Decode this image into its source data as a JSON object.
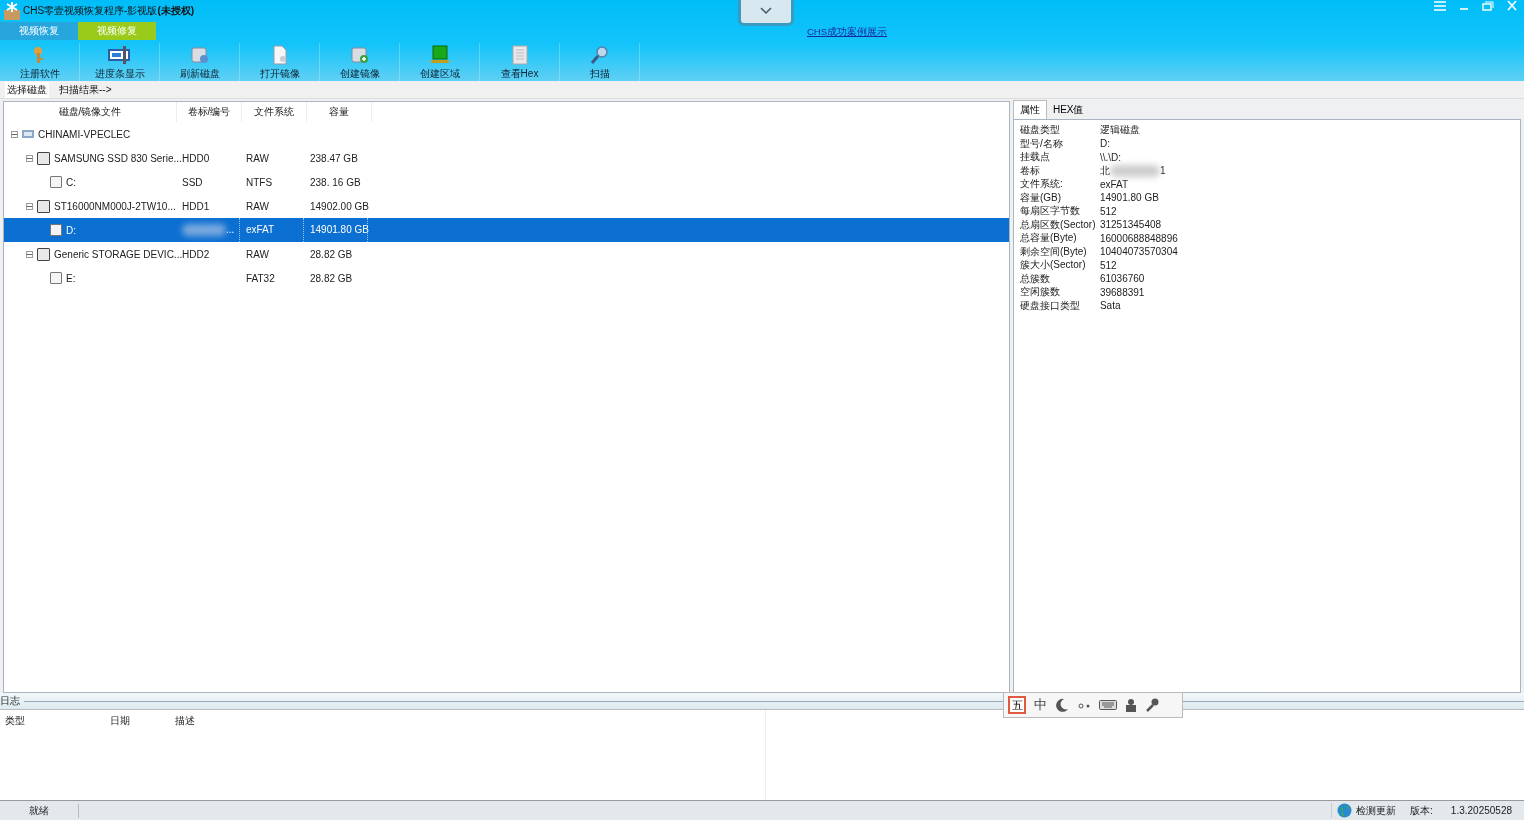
{
  "window": {
    "title": "CHS零壹视频恢复程序-影视版",
    "title_suffix": "(未授权)"
  },
  "mode_tabs": [
    {
      "label": "视频恢复",
      "selected": false
    },
    {
      "label": "视频修复",
      "selected": true
    }
  ],
  "link": "CHS成功案例展示",
  "toolbar": [
    {
      "kind": "key",
      "label": "注册软件"
    },
    {
      "kind": "monitor",
      "label": "进度条显示"
    },
    {
      "kind": "disk-refresh",
      "label": "刷新磁盘"
    },
    {
      "kind": "document",
      "label": "打开镜像"
    },
    {
      "kind": "disk-add",
      "label": "创建镜像"
    },
    {
      "kind": "green-block",
      "label": "创建区域"
    },
    {
      "kind": "hex",
      "label": "查看Hex"
    },
    {
      "kind": "magnifier",
      "label": "扫描"
    }
  ],
  "steps": [
    {
      "label": "选择磁盘",
      "selected": true
    },
    {
      "label": "扫描结果-->",
      "selected": false
    }
  ],
  "tree": {
    "columns": [
      "磁盘/镜像文件",
      "卷标/编号",
      "文件系统",
      "容量"
    ],
    "rows": [
      {
        "kind": "computer",
        "name": "CHINAMI-VPECLEC",
        "expanded": true,
        "children": [
          {
            "kind": "disk",
            "name": "SAMSUNG SSD 830 Serie...",
            "volume": "HDD0",
            "fs": "RAW",
            "size": "238.47 GB",
            "expanded": true,
            "selected": false,
            "children": [
              {
                "kind": "partition",
                "name": "C:",
                "volume": "SSD",
                "fs": "NTFS",
                "size": "238. 16 GB",
                "selected": false
              }
            ]
          },
          {
            "kind": "disk",
            "name": "ST16000NM000J-2TW10...",
            "volume": "HDD1",
            "fs": "RAW",
            "size": "14902.00 GB",
            "expanded": true,
            "selected": false,
            "children": [
              {
                "kind": "partition",
                "name": "D:",
                "volume": "...",
                "redacted": true,
                "fs": "exFAT",
                "size": "14901.80 GB",
                "selected": true
              }
            ]
          },
          {
            "kind": "disk",
            "name": "Generic STORAGE DEVIC...",
            "volume": "HDD2",
            "fs": "RAW",
            "size": "28.82 GB",
            "expanded": true,
            "selected": false,
            "children": [
              {
                "kind": "partition",
                "name": "E:",
                "fs": "FAT32",
                "size": "28.82 GB",
                "selected": false
              }
            ]
          }
        ]
      }
    ]
  },
  "props_tabs": [
    {
      "label": "属性",
      "selected": true
    },
    {
      "label": "HEX值",
      "selected": false
    }
  ],
  "properties": [
    {
      "label": "磁盘类型",
      "value": "逻辑磁盘"
    },
    {
      "label": "型号/名称",
      "value": "D:"
    },
    {
      "label": "挂载点",
      "value": "\\\\.\\D:"
    },
    {
      "label": "卷标",
      "value": "北",
      "value_end": "1",
      "redacted": true
    },
    {
      "label": "文件系统:",
      "value": "exFAT"
    },
    {
      "label": "容量(GB)",
      "value": "14901.80 GB"
    },
    {
      "label": "每扇区字节数",
      "value": "512"
    },
    {
      "label": "总扇区数(Sector)",
      "value": "31251345408"
    },
    {
      "label": "总容量(Byte)",
      "value": "16000688848896"
    },
    {
      "label": "剩余空间(Byte)",
      "value": "10404073570304"
    },
    {
      "label": "簇大小(Sector)",
      "value": "512"
    },
    {
      "label": "总簇数",
      "value": "61036760"
    },
    {
      "label": "空闲簇数",
      "value": "39688391"
    },
    {
      "label": "硬盘接口类型",
      "value": "Sata"
    }
  ],
  "log": {
    "title": "日志",
    "columns": [
      "类型",
      "日期",
      "描述"
    ]
  },
  "ime_bar": {
    "mode": "五",
    "lang": "中"
  },
  "status_bar": {
    "text": "就绪",
    "update": "检测更新",
    "version_label": "版本:",
    "version": "1.3.20250528"
  }
}
